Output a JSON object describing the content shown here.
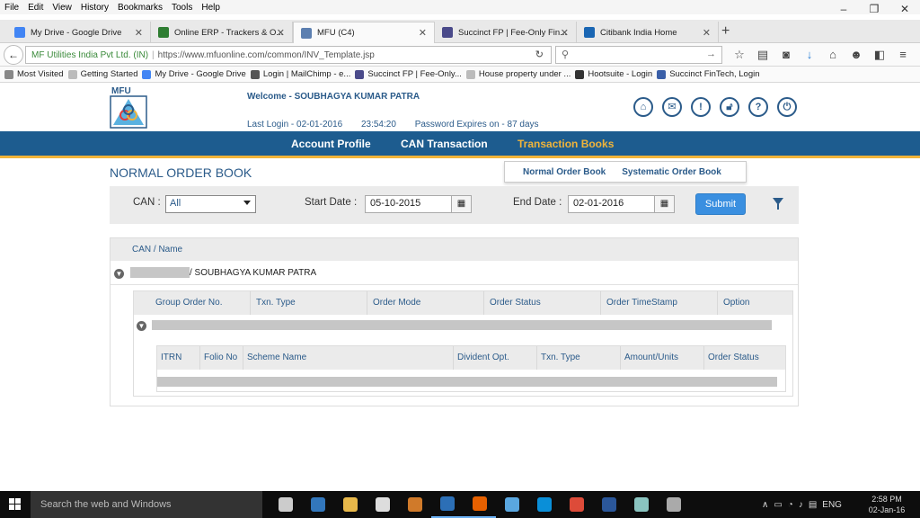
{
  "menu": [
    "File",
    "Edit",
    "View",
    "History",
    "Bookmarks",
    "Tools",
    "Help"
  ],
  "window_controls": {
    "minimize": "–",
    "restore": "❐",
    "close": "✕"
  },
  "tabs": [
    {
      "label": "My Drive - Google Drive",
      "favicon_color": "#4285f4"
    },
    {
      "label": "Online ERP - Trackers & O...",
      "favicon_color": "#2e7d32"
    },
    {
      "label": "MFU (C4)",
      "favicon_color": "#5c7fb0"
    },
    {
      "label": "Succinct FP | Fee-Only Fin...",
      "favicon_color": "#4a4a8a"
    },
    {
      "label": "Citibank India Home",
      "favicon_color": "#1a66b3"
    }
  ],
  "new_tab": "+",
  "urlbar": {
    "site": "MF Utilities India Pvt Ltd. (IN)",
    "url": "https://www.mfuonline.com/common/INV_Template.jsp"
  },
  "bookmarks": [
    {
      "label": "Most Visited",
      "icon_color": "#888888"
    },
    {
      "label": "Getting Started",
      "icon_color": "#bbbbbb"
    },
    {
      "label": "My Drive - Google Drive",
      "icon_color": "#4285f4"
    },
    {
      "label": "Login | MailChimp - e...",
      "icon_color": "#555555"
    },
    {
      "label": "Succinct FP | Fee-Only...",
      "icon_color": "#4a4a8a"
    },
    {
      "label": "House property under ...",
      "icon_color": "#bbbbbb"
    },
    {
      "label": "Hootsuite - Login",
      "icon_color": "#333333"
    },
    {
      "label": "Succinct FinTech, Login",
      "icon_color": "#3a5fa8"
    }
  ],
  "logo_text": "MFU",
  "header": {
    "welcome": "Welcome - SOUBHAGYA KUMAR PATRA",
    "last_login": "Last Login - 02-01-2016",
    "last_login_time": "23:54:20",
    "password_expiry": "Password Expires on - 87 days"
  },
  "main_nav": [
    {
      "label": "Account Profile",
      "active": false
    },
    {
      "label": "CAN Transaction",
      "active": false
    },
    {
      "label": "Transaction Books",
      "active": true
    }
  ],
  "submenu": [
    "Normal Order Book",
    "Systematic Order Book"
  ],
  "page_title": "NORMAL ORDER BOOK",
  "filter": {
    "can_label": "CAN :",
    "can_value": "All",
    "start_label": "Start Date :",
    "start_value": "05-10-2015",
    "end_label": "End Date :",
    "end_value": "02-01-2016",
    "submit": "Submit"
  },
  "results": {
    "header": "CAN / Name",
    "name_suffix": "/ SOUBHAGYA KUMAR PATRA",
    "group_columns": [
      "Group Order No.",
      "Txn. Type",
      "Order Mode",
      "Order Status",
      "Order TimeStamp",
      "Option"
    ],
    "detail_columns": [
      "ITRN",
      "Folio No",
      "Scheme Name",
      "Divident Opt.",
      "Txn. Type",
      "Amount/Units",
      "Order Status"
    ]
  },
  "taskbar": {
    "search": "Search the web and Windows",
    "apps": [
      "#cccccc",
      "#3277bc",
      "#e8b84a",
      "#dddddd",
      "#d07a2a",
      "#2c6fb6",
      "#e66000",
      "#5aa7e0",
      "#0a8fd8",
      "#dd4b39",
      "#2b579a",
      "#8ac4c0",
      "#aaaaaa"
    ],
    "tray": [
      "∧",
      "ENG"
    ],
    "time": "2:58 PM",
    "date": "02-Jan-16"
  }
}
